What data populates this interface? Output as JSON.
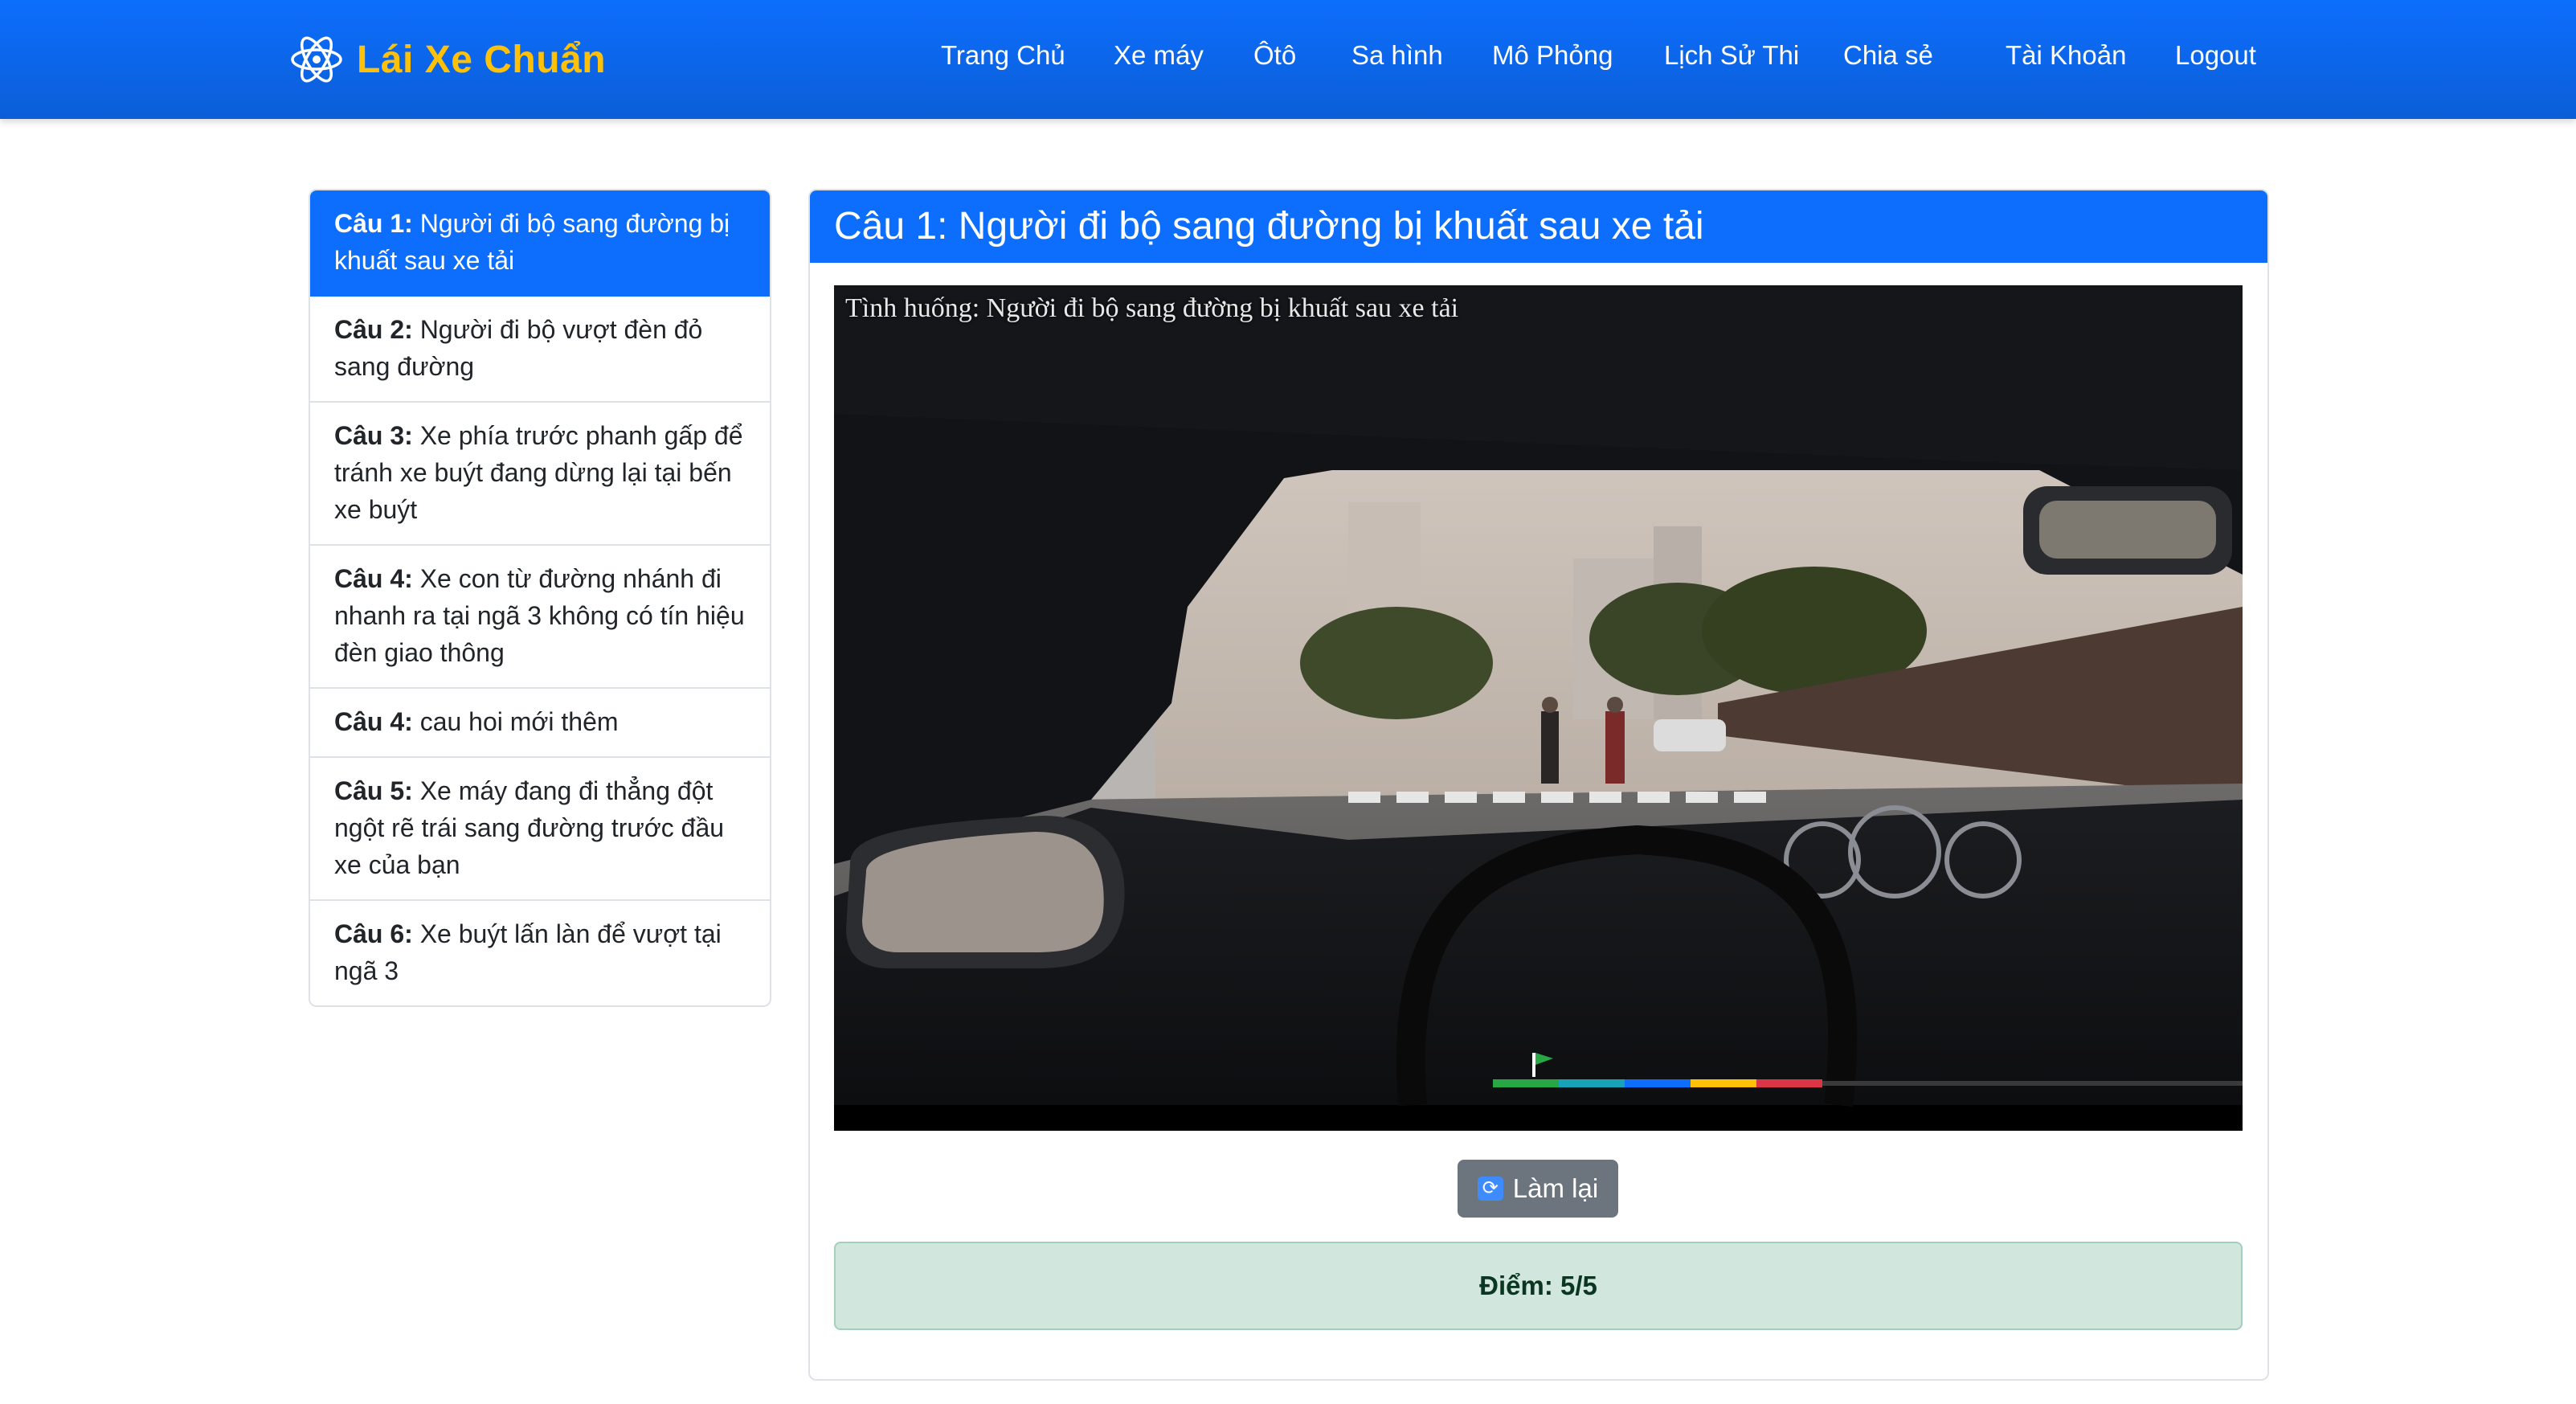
{
  "app": {
    "brand": "Lái Xe Chuẩn",
    "brand_color": "#ffc107",
    "accent": "#0d6efd"
  },
  "nav": {
    "home": "Trang Chủ",
    "motorbike": "Xe máy",
    "car": "Ôtô",
    "course": "Sa hình",
    "simulation": "Mô Phỏng",
    "history": "Lịch Sử Thi",
    "share": "Chia sẻ",
    "account": "Tài Khoản",
    "logout": "Logout"
  },
  "sidebar": {
    "items": [
      {
        "num": "Câu 1:",
        "text": " Người đi bộ sang đường bị khuất sau xe tải",
        "active": true
      },
      {
        "num": "Câu 2:",
        "text": " Người đi bộ vượt đèn đỏ sang đường",
        "active": false
      },
      {
        "num": "Câu 3:",
        "text": " Xe phía trước phanh gấp để tránh xe buýt đang dừng lại tại bến xe buýt",
        "active": false
      },
      {
        "num": "Câu 4:",
        "text": " Xe con từ đường nhánh đi nhanh ra tại ngã 3 không có tín hiệu đèn giao thông",
        "active": false
      },
      {
        "num": "Câu 4:",
        "text": " cau hoi mới thêm",
        "active": false
      },
      {
        "num": "Câu 5:",
        "text": " Xe máy đang đi thẳng đột ngột rẽ trái sang đường trước đầu xe của bạn",
        "active": false
      },
      {
        "num": "Câu 6:",
        "text": " Xe buýt lấn làn để vượt tại ngã 3",
        "active": false
      }
    ]
  },
  "main": {
    "title": "Câu 1: Người đi bộ sang đường bị khuất sau xe tải",
    "video_caption": "Tình huống: Người đi bộ sang đường bị khuất sau xe tải",
    "video_progress_colors": [
      "#28a745",
      "#17a2b8",
      "#0d6efd",
      "#ffc107",
      "#dc3545"
    ],
    "redo_button": "Làm lại",
    "redo_icon": "refresh-icon",
    "score": "Điểm: 5/5"
  }
}
